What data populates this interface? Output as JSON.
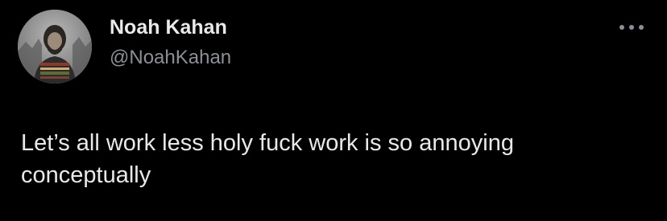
{
  "tweet": {
    "author": {
      "display_name": "Noah Kahan",
      "handle": "@NoahKahan",
      "avatar_icon": "profile-photo"
    },
    "more_icon": "more-options-icon",
    "text": "Let’s all work less holy fuck work is so annoying conceptually"
  },
  "colors": {
    "background": "#000000",
    "primary_text": "#e7e9ea",
    "secondary_text": "#8b9096"
  }
}
